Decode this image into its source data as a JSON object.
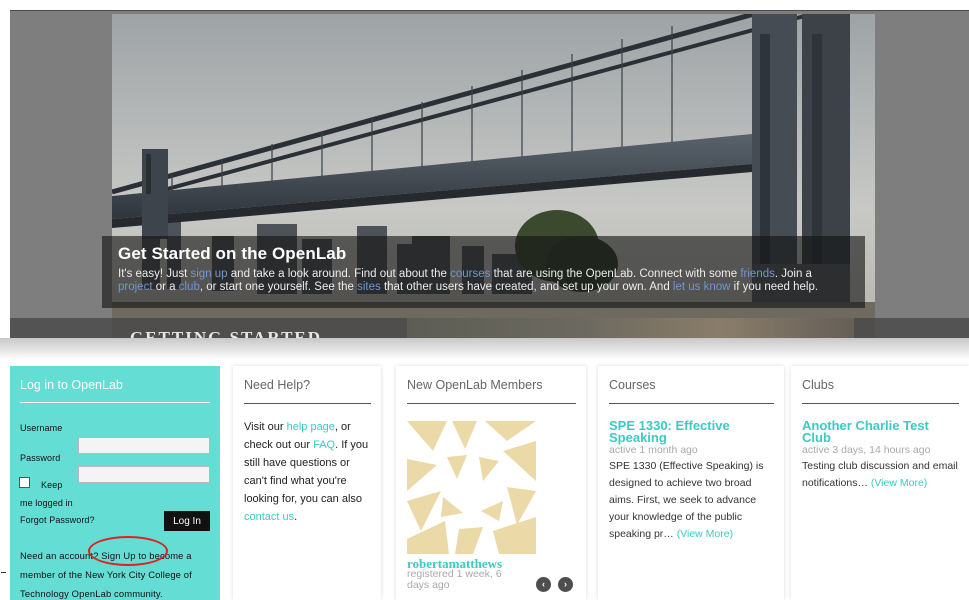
{
  "hero": {
    "title": "Get Started on the OpenLab",
    "text_1": "It's easy! Just ",
    "link_signup": "sign up",
    "text_2": " and take a look around. Find out about the ",
    "link_courses": "courses",
    "text_3": " that are using the OpenLab. Connect with some ",
    "link_friends": "friends",
    "text_4": ". Join a ",
    "link_project": "project",
    "text_5": " or a ",
    "link_club": "club",
    "text_6": ", or start one yourself. See the ",
    "link_sites": "sites",
    "text_7": " that other users have created, and set up your own. And ",
    "link_letusknow": "let us know",
    "text_8": " if you need help.",
    "ghost_heading": "GETTING STARTED"
  },
  "login": {
    "title": "Log in to OpenLab",
    "username_label": "Username",
    "password_label": "Password",
    "keep_label_1": "Keep",
    "keep_label_2": "me logged in",
    "forgot": "Forgot Password?",
    "login_button": "Log In",
    "need_account": "Need an account? Sign Up to become a member of the New York City College of Technology OpenLab community."
  },
  "help": {
    "title": "Need Help?",
    "t1": "Visit our ",
    "link_help": "help page",
    "t2": ", or check out our ",
    "link_faq": "FAQ",
    "t3": ". If you still have questions or can't find what you're looking for, you can also ",
    "link_contact": "contact us",
    "t4": "."
  },
  "members": {
    "title": "New OpenLab Members",
    "name": "robertamatthews",
    "meta": "registered 1 week, 6 days ago",
    "prev": "‹",
    "next": "›"
  },
  "courses": {
    "title": "Courses",
    "item_title": "SPE 1330: Effective Speaking",
    "item_meta": "active 1 month ago",
    "item_desc": "SPE 1330 (Effective Speaking) is designed to achieve two broad aims. First, we seek to advance your knowledge of the public speaking pr… ",
    "view_more": "(View More)"
  },
  "clubs": {
    "title": "Clubs",
    "item_title": "Another Charlie Test Club",
    "item_meta": "active 3 days, 14 hours ago",
    "item_desc": "Testing club discussion and email notifications… ",
    "view_more": "(View More)"
  },
  "colors": {
    "accent": "#3ccac4",
    "login_bg": "#64ddd4",
    "annotation_ring": "#dd2222"
  }
}
